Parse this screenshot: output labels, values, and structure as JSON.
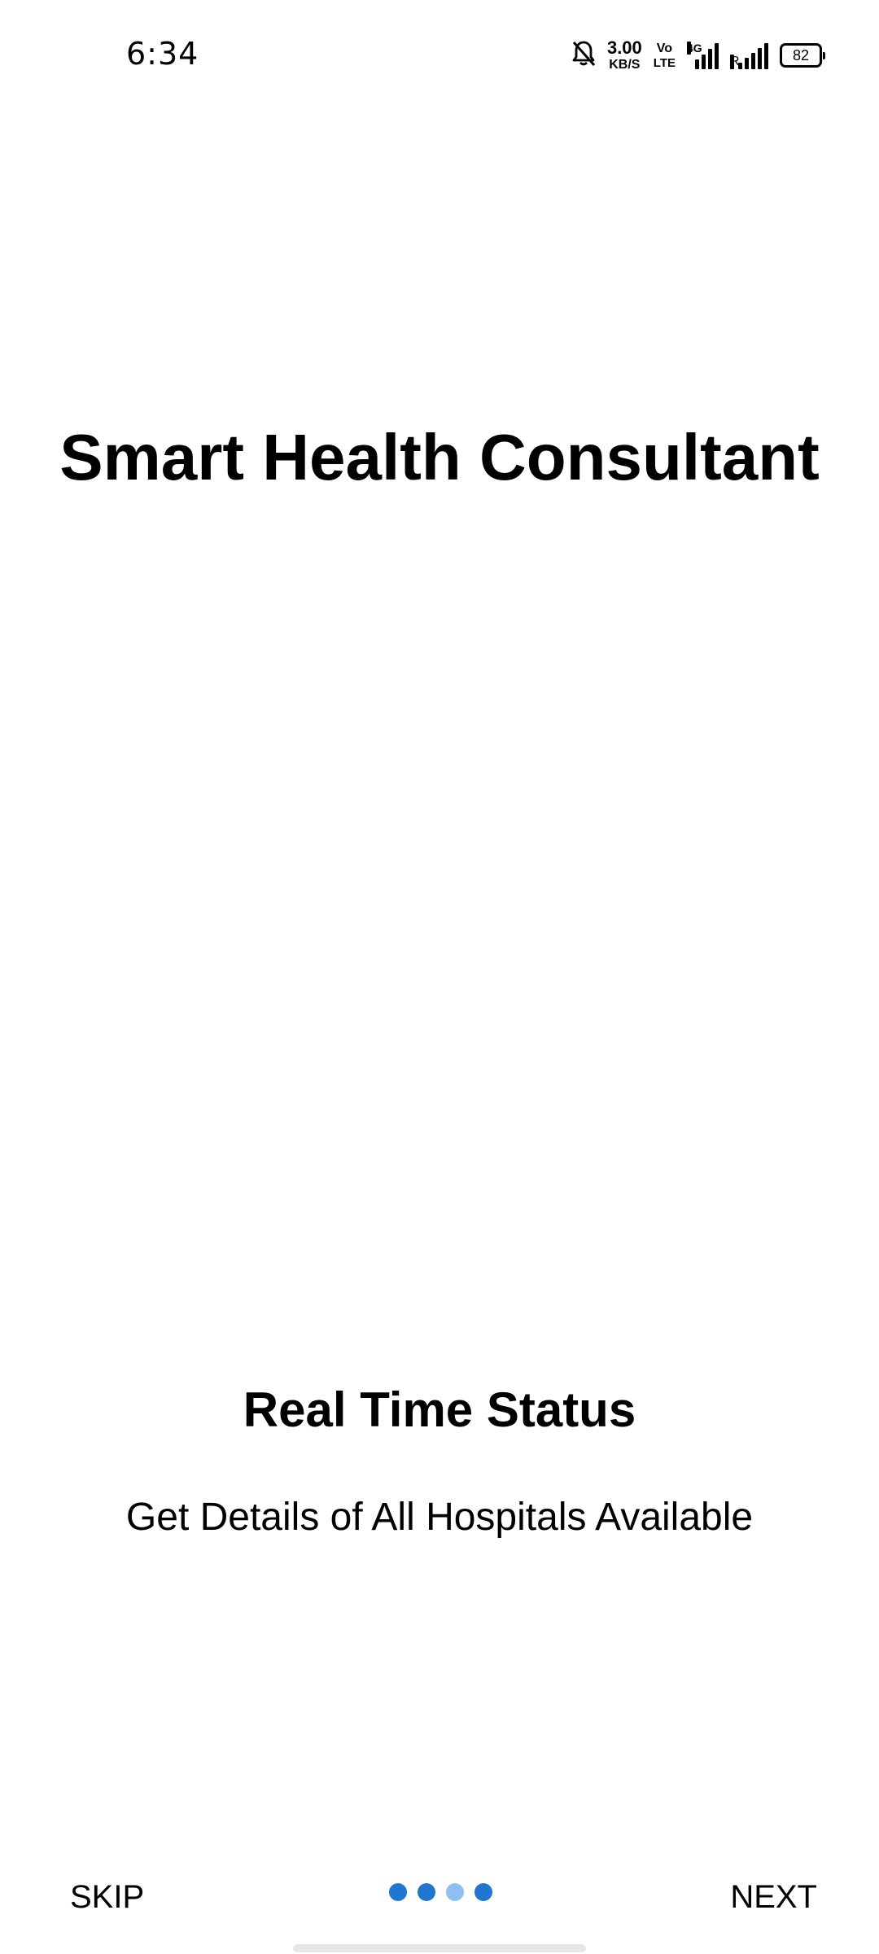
{
  "status_bar": {
    "time": "6:34",
    "net_speed_value": "3.00",
    "net_speed_unit": "KB/S",
    "volte_top": "Vo",
    "volte_bottom": "LTE",
    "network_type": "4G",
    "roaming_label": "R",
    "battery_level": "82",
    "icons": [
      "mute-bell-icon",
      "signal-icon",
      "signal-icon"
    ]
  },
  "main": {
    "app_title": "Smart Health Consultant",
    "slide_heading": "Real Time Status",
    "slide_description": "Get Details of All Hospitals Available"
  },
  "bottom_nav": {
    "skip_label": "SKIP",
    "next_label": "NEXT",
    "page_count": 4,
    "current_page": 3
  },
  "colors": {
    "dot_active": "#2176d2",
    "dot_inactive": "#8fbef0",
    "background": "#ffffff",
    "text": "#000000"
  }
}
